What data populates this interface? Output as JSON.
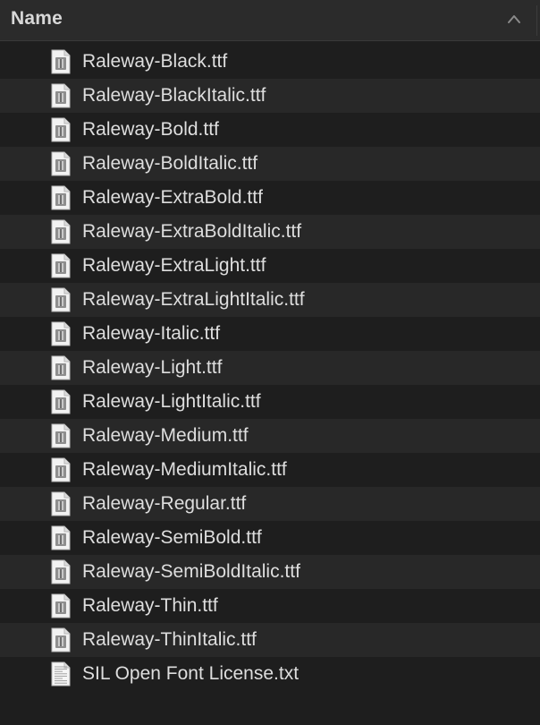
{
  "header": {
    "column_label": "Name",
    "sort_icon": "chevron-up-icon"
  },
  "files": [
    {
      "name": "Raleway-Black.ttf",
      "icon": "font-file-icon"
    },
    {
      "name": "Raleway-BlackItalic.ttf",
      "icon": "font-file-icon"
    },
    {
      "name": "Raleway-Bold.ttf",
      "icon": "font-file-icon"
    },
    {
      "name": "Raleway-BoldItalic.ttf",
      "icon": "font-file-icon"
    },
    {
      "name": "Raleway-ExtraBold.ttf",
      "icon": "font-file-icon"
    },
    {
      "name": "Raleway-ExtraBoldItalic.ttf",
      "icon": "font-file-icon"
    },
    {
      "name": "Raleway-ExtraLight.ttf",
      "icon": "font-file-icon"
    },
    {
      "name": "Raleway-ExtraLightItalic.ttf",
      "icon": "font-file-icon"
    },
    {
      "name": "Raleway-Italic.ttf",
      "icon": "font-file-icon"
    },
    {
      "name": "Raleway-Light.ttf",
      "icon": "font-file-icon"
    },
    {
      "name": "Raleway-LightItalic.ttf",
      "icon": "font-file-icon"
    },
    {
      "name": "Raleway-Medium.ttf",
      "icon": "font-file-icon"
    },
    {
      "name": "Raleway-MediumItalic.ttf",
      "icon": "font-file-icon"
    },
    {
      "name": "Raleway-Regular.ttf",
      "icon": "font-file-icon"
    },
    {
      "name": "Raleway-SemiBold.ttf",
      "icon": "font-file-icon"
    },
    {
      "name": "Raleway-SemiBoldItalic.ttf",
      "icon": "font-file-icon"
    },
    {
      "name": "Raleway-Thin.ttf",
      "icon": "font-file-icon"
    },
    {
      "name": "Raleway-ThinItalic.ttf",
      "icon": "font-file-icon"
    },
    {
      "name": "SIL Open Font License.txt",
      "icon": "text-file-icon"
    }
  ],
  "colors": {
    "background": "#1e1e1e",
    "alt_row": "#282828",
    "header": "#2b2b2b",
    "text": "#dedede"
  }
}
